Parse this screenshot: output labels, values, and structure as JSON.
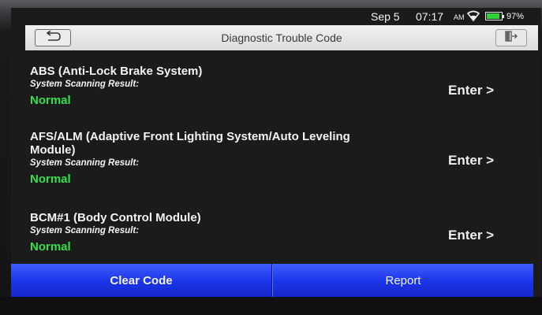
{
  "status_bar": {
    "date": "Sep 5",
    "time": "07:17",
    "ampm": "AM",
    "wifi_icon": "wifi-icon",
    "battery_icon": "battery-icon",
    "battery_percent": "97%"
  },
  "header": {
    "back_icon": "back-arrow-icon",
    "title": "Diagnostic Trouble Code",
    "exit_icon": "exit-icon"
  },
  "systems": [
    {
      "name": "ABS (Anti-Lock Brake System)",
      "result_label": "System Scanning Result:",
      "result": "Normal",
      "enter": "Enter >"
    },
    {
      "name": "AFS/ALM (Adaptive Front Lighting System/Auto Leveling Module)",
      "result_label": "System Scanning Result:",
      "result": "Normal",
      "enter": "Enter >"
    },
    {
      "name": "BCM#1 (Body Control Module)",
      "result_label": "System Scanning Result:",
      "result": "Normal",
      "enter": "Enter >"
    }
  ],
  "footer": {
    "clear_code": "Clear Code",
    "report": "Report"
  },
  "colors": {
    "normal_green": "#35e04b",
    "button_blue": "#1a34e8",
    "screen_background": "#1b1b1c"
  }
}
